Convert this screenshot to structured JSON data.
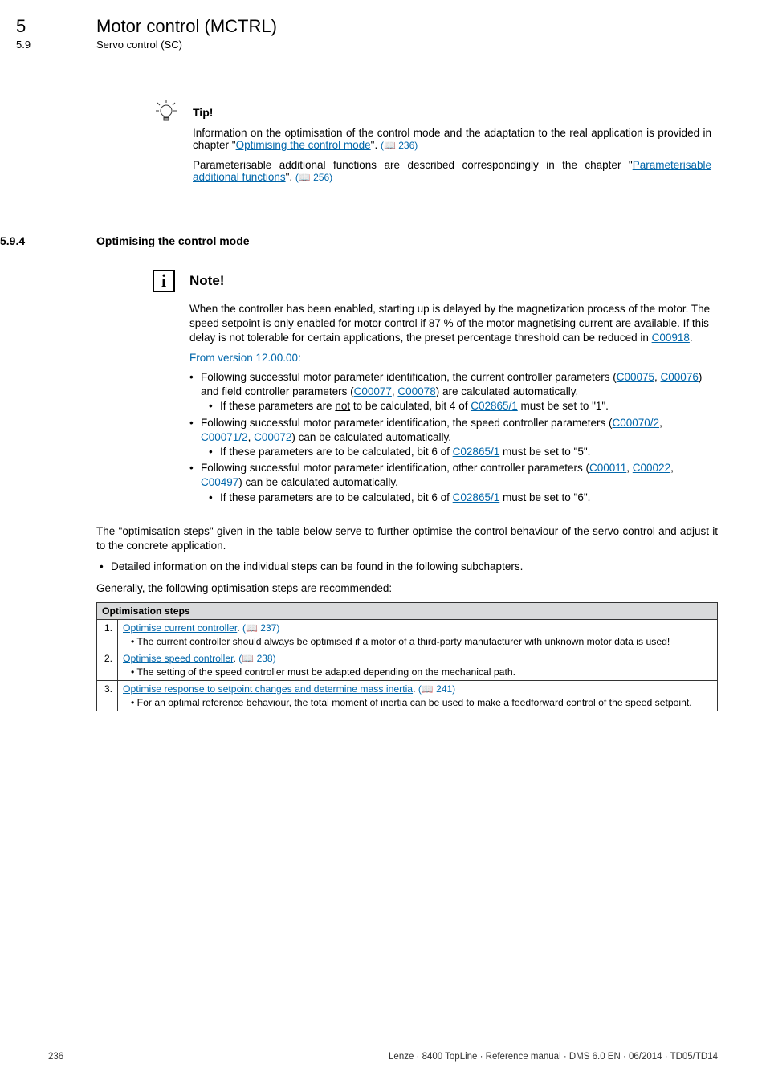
{
  "header": {
    "chapter_num": "5",
    "chapter_title": "Motor control (MCTRL)",
    "subchapter_num": "5.9",
    "subchapter_title": "Servo control (SC)"
  },
  "tip": {
    "label": "Tip!",
    "para1_a": "Information on the optimisation of the control mode and the adaptation to the real application is provided in chapter \"",
    "para1_link": "Optimising the control mode",
    "para1_b": "\". ",
    "para1_ref": "(📖 236)",
    "para2_a": "Parameterisable additional functions are described correspondingly in the chapter \"",
    "para2_link": "Parameterisable additional functions",
    "para2_b": "\". ",
    "para2_ref": "(📖 256)"
  },
  "section": {
    "num": "5.9.4",
    "title": "Optimising the control mode"
  },
  "note": {
    "label": "Note!",
    "p1_a": "When the controller has been enabled, starting up is delayed by the magnetization process of the motor. The speed setpoint is only enabled for motor control if 87 % of the motor magnetising current are available. If this delay is not tolerable for certain applications, the preset percentage threshold can be reduced in ",
    "p1_link": "C00918",
    "p1_b": ".",
    "version": "From version 12.00.00:",
    "b1_a": "Following successful motor parameter identification, the current controller parameters (",
    "b1_l1": "C00075",
    "b1_sep1": ", ",
    "b1_l2": "C00076",
    "b1_mid": ") and field controller parameters (",
    "b1_l3": "C00077",
    "b1_sep2": ", ",
    "b1_l4": "C00078",
    "b1_b": ") are calculated automatically.",
    "b1s_a": "If these parameters are ",
    "b1s_u": "not",
    "b1s_b": " to be calculated, bit 4 of ",
    "b1s_link": "C02865/1",
    "b1s_c": " must be set to \"1\".",
    "b2_a": "Following successful motor parameter identification, the speed controller parameters (",
    "b2_l1": "C00070/2",
    "b2_sep1": ", ",
    "b2_l2": "C00071/2",
    "b2_sep2": ", ",
    "b2_l3": "C00072",
    "b2_b": ") can be calculated automatically.",
    "b2s_a": "If these parameters are to be calculated, bit 6 of ",
    "b2s_link": "C02865/1",
    "b2s_b": " must be set to \"5\".",
    "b3_a": "Following successful motor parameter identification, other controller parameters (",
    "b3_l1": "C00011",
    "b3_sep1": ", ",
    "b3_l2": "C00022",
    "b3_sep2": ", ",
    "b3_l3": "C00497",
    "b3_b": ") can be calculated automatically.",
    "b3s_a": "If these parameters are to be calculated, bit 6 of ",
    "b3s_link": "C02865/1",
    "b3s_b": " must be set to \"6\"."
  },
  "after": {
    "p1": "The \"optimisation steps\" given in the table below serve to further optimise the control behaviour of the servo control and adjust it to the concrete application.",
    "li1": "Detailed information on the individual steps can be found in the following subchapters.",
    "p2": "Generally, the following optimisation steps are recommended:"
  },
  "table": {
    "header": "Optimisation steps",
    "rows": [
      {
        "n": "1.",
        "link": "Optimise current controller",
        "ref": "(📖 237)",
        "sub": "• The current controller should always be optimised if a motor of a third-party manufacturer with unknown motor data is used!"
      },
      {
        "n": "2.",
        "link": "Optimise speed controller",
        "ref": "(📖 238)",
        "sub": "• The setting of the speed controller must be adapted depending on the mechanical path."
      },
      {
        "n": "3.",
        "link": "Optimise response to setpoint changes and determine mass inertia",
        "ref": "(📖 241)",
        "sub": "• For an optimal reference behaviour, the total moment of inertia can be used to make a feedforward control of the speed setpoint."
      }
    ]
  },
  "footer": {
    "page": "236",
    "info": "Lenze · 8400 TopLine · Reference manual · DMS 6.0 EN · 06/2014 · TD05/TD14"
  }
}
